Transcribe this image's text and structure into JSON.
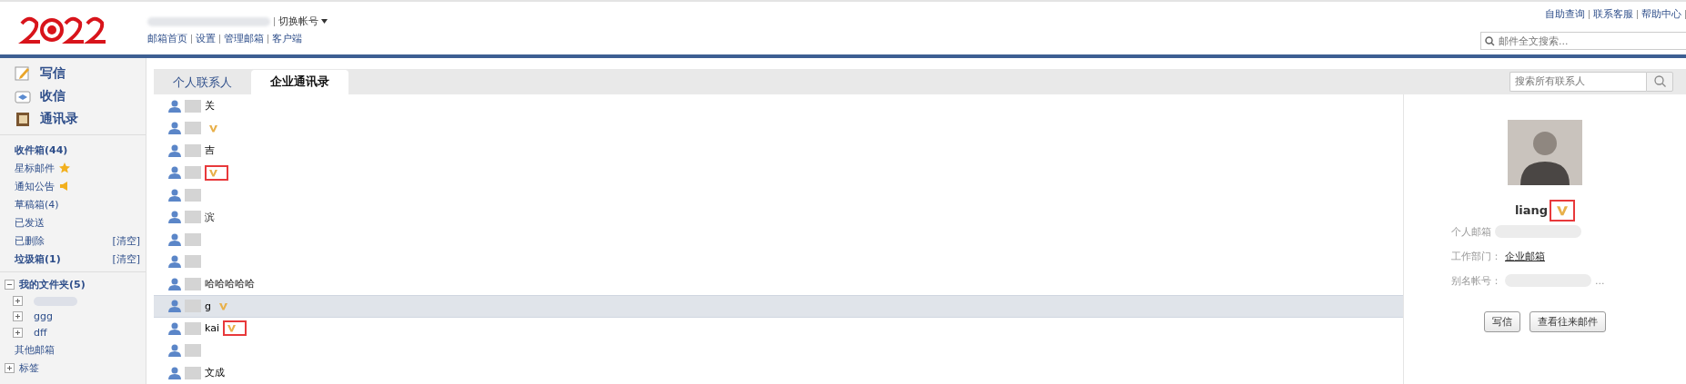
{
  "header": {
    "account_switch": "切换帐号",
    "nav_links": [
      "邮箱首页",
      "设置",
      "管理邮箱",
      "客户端"
    ],
    "top_links": [
      "自助查询",
      "联系客服",
      "帮助中心"
    ],
    "mail_search": {
      "placeholder": "邮件全文搜索..."
    }
  },
  "sidebar": {
    "actions": [
      {
        "kind": "write",
        "label": "写信"
      },
      {
        "kind": "receive",
        "label": "收信"
      },
      {
        "kind": "contacts",
        "label": "通讯录"
      }
    ],
    "folders": [
      {
        "kind": "plain",
        "label": "收件箱(44)",
        "bold": true
      },
      {
        "kind": "starred",
        "label": "星标邮件",
        "bold": false
      },
      {
        "kind": "notice",
        "label": "通知公告",
        "bold": false
      },
      {
        "kind": "plain",
        "label": "草稿箱(4)",
        "bold": false
      },
      {
        "kind": "plain",
        "label": "已发送",
        "bold": false
      },
      {
        "kind": "plain",
        "label": "已删除",
        "bold": false,
        "action": "[清空]"
      },
      {
        "kind": "plain",
        "label": "垃圾箱(1)",
        "bold": true,
        "action": "[清空]"
      }
    ],
    "my_folders": {
      "label": "我的文件夹(5)",
      "expanded": true,
      "children": [
        {
          "expanded": false
        },
        {
          "label": "ggg",
          "expanded": false
        },
        {
          "label": "dff",
          "expanded": false
        }
      ]
    },
    "other_mailboxes": "其他邮箱",
    "tags": {
      "label": "标签",
      "expanded": false
    }
  },
  "tabs": [
    {
      "label": "个人联系人",
      "selected": false
    },
    {
      "label": "企业通讯录",
      "selected": true
    }
  ],
  "contact_search": {
    "placeholder": "搜索所有联系人"
  },
  "contacts": [
    {
      "name": "关",
      "vip": false,
      "selected": false
    },
    {
      "vip": true,
      "marked": false,
      "selected": false
    },
    {
      "name": "吉",
      "vip": false,
      "selected": false
    },
    {
      "vip": true,
      "marked": true,
      "selected": false
    },
    {
      "vip": false,
      "selected": false
    },
    {
      "name": "滨",
      "vip": false,
      "selected": false
    },
    {
      "vip": false,
      "selected": false
    },
    {
      "vip": false,
      "selected": false
    },
    {
      "name": "哈哈哈哈哈",
      "vip": false,
      "selected": false
    },
    {
      "name": "g",
      "vip": true,
      "marked": false,
      "selected": true
    },
    {
      "name": "kai",
      "vip": true,
      "marked": true,
      "selected": false
    },
    {
      "vip": false,
      "selected": false
    },
    {
      "name": "文成",
      "vip": false,
      "selected": false
    }
  ],
  "detail": {
    "name": "liang",
    "vip": true,
    "marked": true,
    "fields": [
      {
        "label": "个人邮箱"
      },
      {
        "label": "工作部门：",
        "value": "企业邮箱"
      },
      {
        "label": "别名帐号：",
        "value": "..."
      }
    ],
    "buttons": [
      "写信",
      "查看往来邮件"
    ]
  }
}
